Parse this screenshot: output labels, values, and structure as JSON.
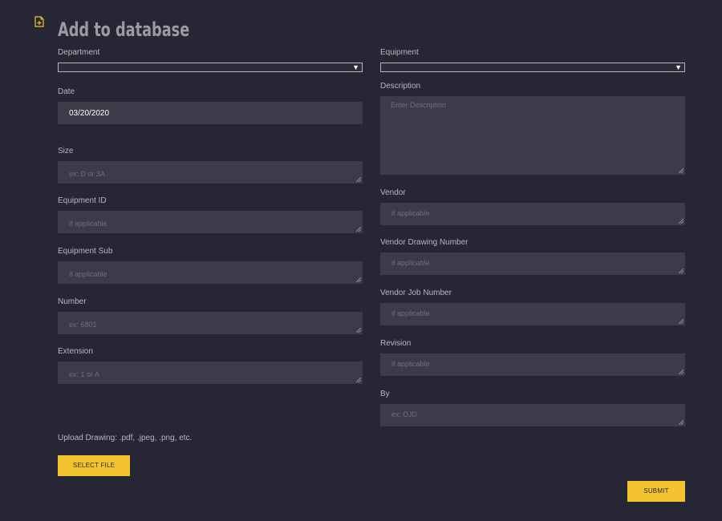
{
  "page": {
    "title": "Add to database"
  },
  "left": {
    "department_label": "Department",
    "date_label": "Date",
    "date_value": "03/20/2020",
    "size_label": "Size",
    "size_placeholder": "ex: D or 3A",
    "equipment_id_label": "Equipment ID",
    "equipment_id_placeholder": "if applicable",
    "equipment_sub_label": "Equipment Sub",
    "equipment_sub_placeholder": "if applicable",
    "number_label": "Number",
    "number_placeholder": "ex: 6801",
    "extension_label": "Extension",
    "extension_placeholder": "ex: 1 or A",
    "upload_label": "Upload Drawing: .pdf, .jpeg, .png, etc.",
    "select_file_label": "SELECT FILE"
  },
  "right": {
    "equipment_label": "Equipment",
    "description_label": "Description",
    "description_placeholder": "Enter Description",
    "vendor_label": "Vendor",
    "vendor_placeholder": "if applicable",
    "vendor_drawing_label": "Vendor Drawing Number",
    "vendor_drawing_placeholder": "if applicable",
    "vendor_job_label": "Vendor Job Number",
    "vendor_job_placeholder": "if applicable",
    "revision_label": "Revision",
    "revision_placeholder": "if applicable",
    "by_label": "By",
    "by_placeholder": "ex: DJD",
    "submit_label": "SUBMIT"
  },
  "icons": {
    "title": "file-add-icon",
    "dropdown": "caret-down-icon"
  },
  "colors": {
    "accent": "#f4c430",
    "background": "#262634",
    "field": "#3b3b49"
  }
}
